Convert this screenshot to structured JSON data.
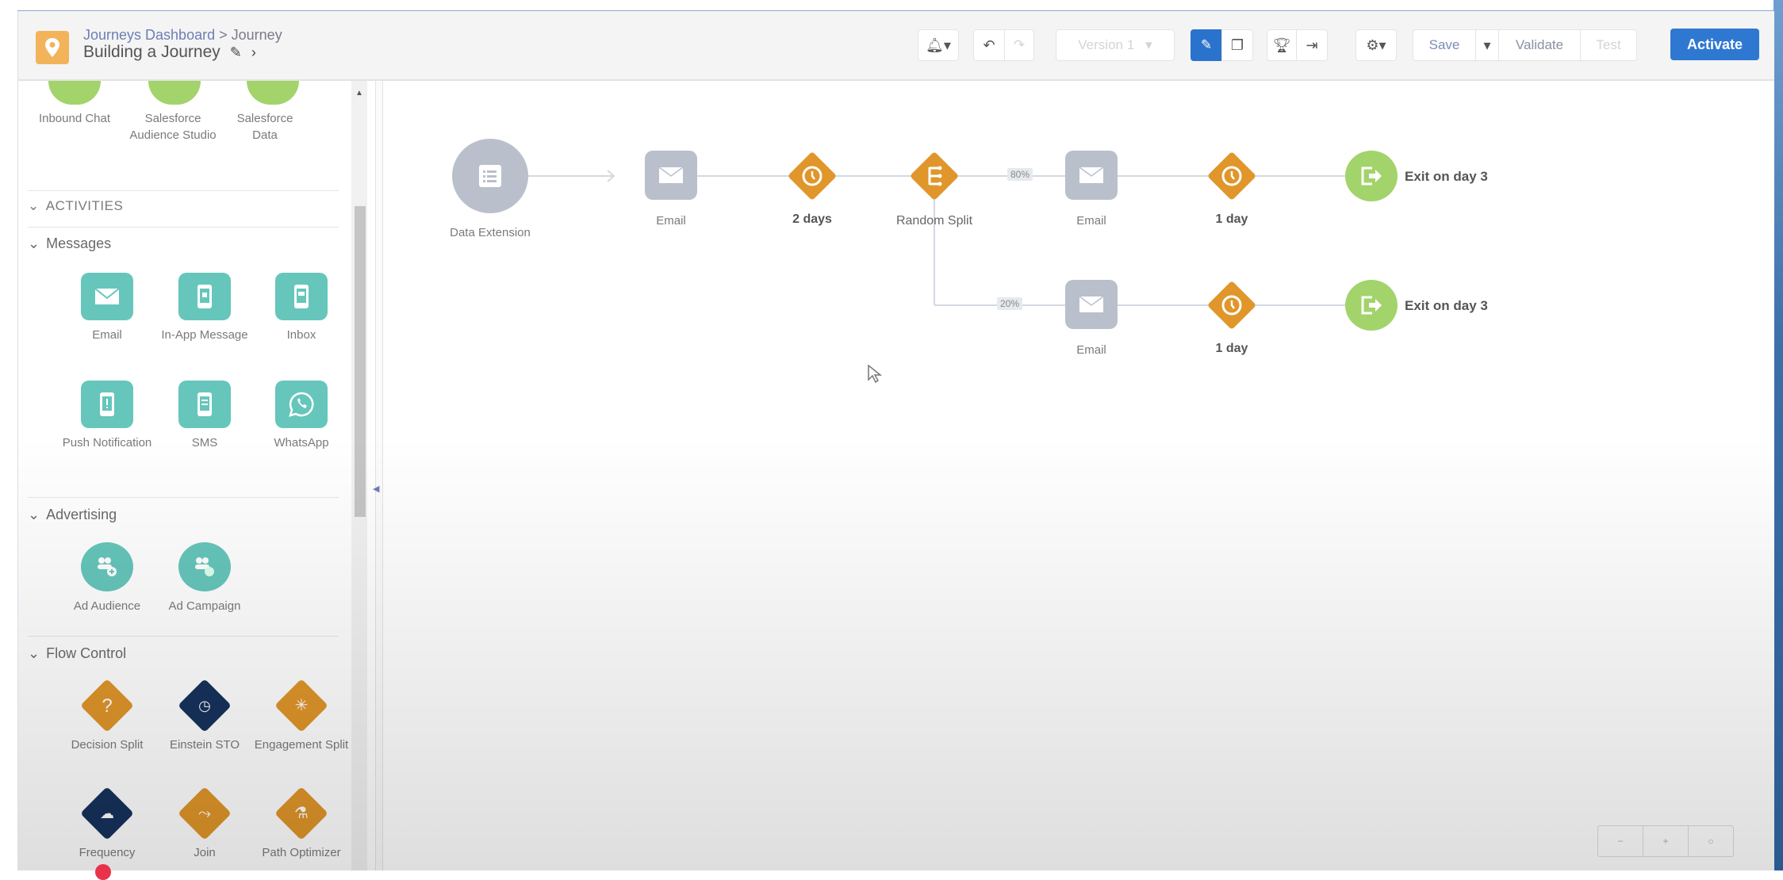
{
  "header": {
    "breadcrumb_link": "Journeys Dashboard",
    "breadcrumb_sep": ">",
    "breadcrumb_current": "Journey",
    "title": "Building a Journey",
    "edit_icon": "pencil-icon",
    "next_icon": "chevron-right-icon",
    "logo_icon": "location-pin-icon"
  },
  "toolbar": {
    "notifications_icon": "bell-signal-icon",
    "undo_icon": "undo-icon",
    "redo_icon": "redo-icon",
    "version_label": "Version 1",
    "edit_mode_icon": "pencil-icon",
    "overview_icon": "layers-icon",
    "goal_icon": "trophy-icon",
    "exit_criteria_icon": "exit-icon",
    "settings_icon": "gear-icon",
    "save_label": "Save",
    "validate_label": "Validate",
    "test_label": "Test",
    "activate_label": "Activate",
    "accent": "#2f78d2"
  },
  "panel": {
    "entry_sources": [
      {
        "label": "Inbound Chat"
      },
      {
        "label": "Salesforce Audience Studio"
      },
      {
        "label": "Salesforce Data"
      }
    ],
    "activities_heading": "ACTIVITIES",
    "messages": {
      "heading": "Messages",
      "items": [
        {
          "label": "Email",
          "icon": "envelope-icon"
        },
        {
          "label": "In-App Message",
          "icon": "mobile-message-icon"
        },
        {
          "label": "Inbox",
          "icon": "mobile-inbox-icon"
        },
        {
          "label": "Push Notification",
          "icon": "mobile-alert-icon"
        },
        {
          "label": "SMS",
          "icon": "mobile-sms-icon"
        },
        {
          "label": "WhatsApp",
          "icon": "whatsapp-icon"
        }
      ]
    },
    "advertising": {
      "heading": "Advertising",
      "items": [
        {
          "label": "Ad Audience",
          "icon": "audience-add-icon"
        },
        {
          "label": "Ad Campaign",
          "icon": "audience-campaign-icon"
        }
      ]
    },
    "flow_control": {
      "heading": "Flow Control",
      "items": [
        {
          "label": "Decision Split",
          "icon": "question-icon"
        },
        {
          "label": "Einstein STO",
          "icon": "einstein-clock-icon"
        },
        {
          "label": "Engagement Split",
          "icon": "click-cursor-icon"
        },
        {
          "label": "Frequency",
          "icon": "einstein-frequency-icon"
        },
        {
          "label": "Join",
          "icon": "join-icon"
        },
        {
          "label": "Path Optimizer",
          "icon": "flask-icon"
        }
      ]
    }
  },
  "canvas": {
    "entry": {
      "label": "Data Extension"
    },
    "nodes": {
      "email1": "Email",
      "wait1": "2 days",
      "split": "Random Split",
      "upper_pct": "80%",
      "lower_pct": "20%",
      "email_upper": "Email",
      "wait_upper": "1 day",
      "exit_upper": "Exit on day 3",
      "email_lower": "Email",
      "wait_lower": "1 day",
      "exit_lower": "Exit on day 3"
    },
    "zoom_controls": [
      "−",
      "+",
      "○"
    ]
  },
  "colors": {
    "activity_teal": "#66c6bb",
    "wait_orange": "#e0962a",
    "einstein_navy": "#16325c",
    "exit_green": "#a3d36b",
    "inactive_gray": "#b9c0cc"
  }
}
